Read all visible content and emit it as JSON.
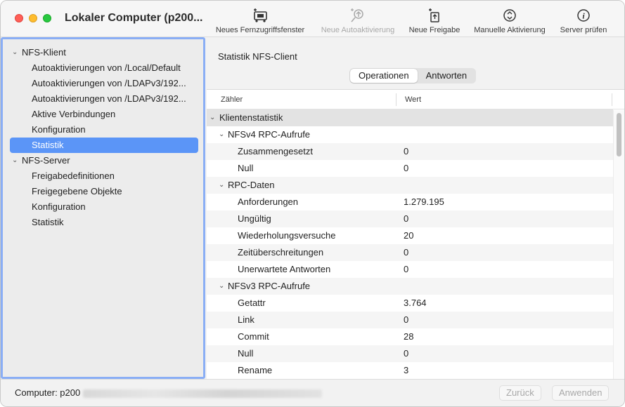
{
  "window": {
    "title": "Lokaler Computer (p200..."
  },
  "toolbar": {
    "items": [
      {
        "label": "Neues Fernzugriffsfenster",
        "icon": "remote-window-icon",
        "enabled": true
      },
      {
        "label": "Neue Autoaktivierung",
        "icon": "auto-mount-icon",
        "enabled": false
      },
      {
        "label": "Neue Freigabe",
        "icon": "new-share-icon",
        "enabled": true
      },
      {
        "label": "Manuelle Aktivierung",
        "icon": "manual-mount-icon",
        "enabled": true
      },
      {
        "label": "Server prüfen",
        "icon": "info-icon",
        "enabled": true
      }
    ]
  },
  "sidebar": {
    "items": [
      {
        "label": "NFS-Klient",
        "level": 0,
        "expanded": true
      },
      {
        "label": "Autoaktivierungen von /Local/Default",
        "level": 1
      },
      {
        "label": "Autoaktivierungen von /LDAPv3/192...",
        "level": 1
      },
      {
        "label": "Autoaktivierungen von /LDAPv3/192...",
        "level": 1
      },
      {
        "label": "Aktive Verbindungen",
        "level": 1
      },
      {
        "label": "Konfiguration",
        "level": 1
      },
      {
        "label": "Statistik",
        "level": 1,
        "selected": true
      },
      {
        "label": "NFS-Server",
        "level": 0,
        "expanded": true
      },
      {
        "label": "Freigabedefinitionen",
        "level": 1
      },
      {
        "label": "Freigegebene Objekte",
        "level": 1
      },
      {
        "label": "Konfiguration",
        "level": 1
      },
      {
        "label": "Statistik",
        "level": 1
      }
    ]
  },
  "main": {
    "title": "Statistik NFS-Client",
    "tabs": [
      {
        "label": "Operationen",
        "active": true
      },
      {
        "label": "Antworten",
        "active": false
      }
    ],
    "columns": {
      "name": "Zähler",
      "value": "Wert"
    },
    "rows": [
      {
        "name": "Klientenstatistik",
        "value": "",
        "level": 0,
        "group": true
      },
      {
        "name": "NFSv4 RPC-Aufrufe",
        "value": "",
        "level": 1,
        "group": true
      },
      {
        "name": "Zusammengesetzt",
        "value": "0",
        "level": 2
      },
      {
        "name": "Null",
        "value": "0",
        "level": 2
      },
      {
        "name": "RPC-Daten",
        "value": "",
        "level": 1,
        "group": true
      },
      {
        "name": "Anforderungen",
        "value": "1.279.195",
        "level": 2
      },
      {
        "name": "Ungültig",
        "value": "0",
        "level": 2
      },
      {
        "name": "Wiederholungsversuche",
        "value": "20",
        "level": 2
      },
      {
        "name": "Zeitüberschreitungen",
        "value": "0",
        "level": 2
      },
      {
        "name": "Unerwartete Antworten",
        "value": "0",
        "level": 2
      },
      {
        "name": "NFSv3 RPC-Aufrufe",
        "value": "",
        "level": 1,
        "group": true
      },
      {
        "name": "Getattr",
        "value": "3.764",
        "level": 2
      },
      {
        "name": "Link",
        "value": "0",
        "level": 2
      },
      {
        "name": "Commit",
        "value": "28",
        "level": 2
      },
      {
        "name": "Null",
        "value": "0",
        "level": 2
      },
      {
        "name": "Rename",
        "value": "3",
        "level": 2
      }
    ]
  },
  "footer": {
    "computer_label": "Computer: p200",
    "back_button": "Zurück",
    "apply_button": "Anwenden"
  },
  "colors": {
    "selection": "#5b95f7",
    "sidebar_focus_ring": "#8aaef5",
    "close": "#ff5f57",
    "minimize": "#febc2e",
    "maximize": "#28c840"
  }
}
